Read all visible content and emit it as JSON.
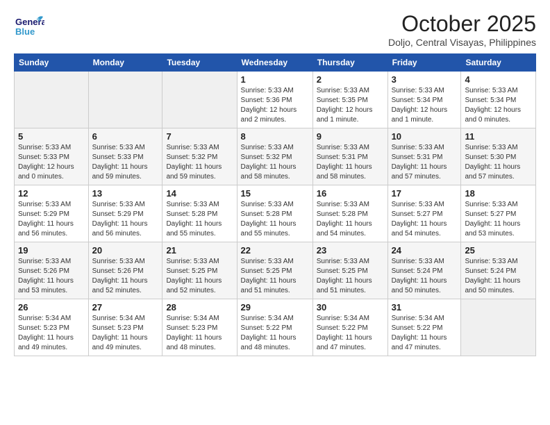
{
  "header": {
    "logo_line1": "General",
    "logo_line2": "Blue",
    "month_title": "October 2025",
    "location": "Doljo, Central Visayas, Philippines"
  },
  "weekdays": [
    "Sunday",
    "Monday",
    "Tuesday",
    "Wednesday",
    "Thursday",
    "Friday",
    "Saturday"
  ],
  "weeks": [
    [
      {
        "day": "",
        "info": ""
      },
      {
        "day": "",
        "info": ""
      },
      {
        "day": "",
        "info": ""
      },
      {
        "day": "1",
        "info": "Sunrise: 5:33 AM\nSunset: 5:36 PM\nDaylight: 12 hours\nand 2 minutes."
      },
      {
        "day": "2",
        "info": "Sunrise: 5:33 AM\nSunset: 5:35 PM\nDaylight: 12 hours\nand 1 minute."
      },
      {
        "day": "3",
        "info": "Sunrise: 5:33 AM\nSunset: 5:34 PM\nDaylight: 12 hours\nand 1 minute."
      },
      {
        "day": "4",
        "info": "Sunrise: 5:33 AM\nSunset: 5:34 PM\nDaylight: 12 hours\nand 0 minutes."
      }
    ],
    [
      {
        "day": "5",
        "info": "Sunrise: 5:33 AM\nSunset: 5:33 PM\nDaylight: 12 hours\nand 0 minutes."
      },
      {
        "day": "6",
        "info": "Sunrise: 5:33 AM\nSunset: 5:33 PM\nDaylight: 11 hours\nand 59 minutes."
      },
      {
        "day": "7",
        "info": "Sunrise: 5:33 AM\nSunset: 5:32 PM\nDaylight: 11 hours\nand 59 minutes."
      },
      {
        "day": "8",
        "info": "Sunrise: 5:33 AM\nSunset: 5:32 PM\nDaylight: 11 hours\nand 58 minutes."
      },
      {
        "day": "9",
        "info": "Sunrise: 5:33 AM\nSunset: 5:31 PM\nDaylight: 11 hours\nand 58 minutes."
      },
      {
        "day": "10",
        "info": "Sunrise: 5:33 AM\nSunset: 5:31 PM\nDaylight: 11 hours\nand 57 minutes."
      },
      {
        "day": "11",
        "info": "Sunrise: 5:33 AM\nSunset: 5:30 PM\nDaylight: 11 hours\nand 57 minutes."
      }
    ],
    [
      {
        "day": "12",
        "info": "Sunrise: 5:33 AM\nSunset: 5:29 PM\nDaylight: 11 hours\nand 56 minutes."
      },
      {
        "day": "13",
        "info": "Sunrise: 5:33 AM\nSunset: 5:29 PM\nDaylight: 11 hours\nand 56 minutes."
      },
      {
        "day": "14",
        "info": "Sunrise: 5:33 AM\nSunset: 5:28 PM\nDaylight: 11 hours\nand 55 minutes."
      },
      {
        "day": "15",
        "info": "Sunrise: 5:33 AM\nSunset: 5:28 PM\nDaylight: 11 hours\nand 55 minutes."
      },
      {
        "day": "16",
        "info": "Sunrise: 5:33 AM\nSunset: 5:28 PM\nDaylight: 11 hours\nand 54 minutes."
      },
      {
        "day": "17",
        "info": "Sunrise: 5:33 AM\nSunset: 5:27 PM\nDaylight: 11 hours\nand 54 minutes."
      },
      {
        "day": "18",
        "info": "Sunrise: 5:33 AM\nSunset: 5:27 PM\nDaylight: 11 hours\nand 53 minutes."
      }
    ],
    [
      {
        "day": "19",
        "info": "Sunrise: 5:33 AM\nSunset: 5:26 PM\nDaylight: 11 hours\nand 53 minutes."
      },
      {
        "day": "20",
        "info": "Sunrise: 5:33 AM\nSunset: 5:26 PM\nDaylight: 11 hours\nand 52 minutes."
      },
      {
        "day": "21",
        "info": "Sunrise: 5:33 AM\nSunset: 5:25 PM\nDaylight: 11 hours\nand 52 minutes."
      },
      {
        "day": "22",
        "info": "Sunrise: 5:33 AM\nSunset: 5:25 PM\nDaylight: 11 hours\nand 51 minutes."
      },
      {
        "day": "23",
        "info": "Sunrise: 5:33 AM\nSunset: 5:25 PM\nDaylight: 11 hours\nand 51 minutes."
      },
      {
        "day": "24",
        "info": "Sunrise: 5:33 AM\nSunset: 5:24 PM\nDaylight: 11 hours\nand 50 minutes."
      },
      {
        "day": "25",
        "info": "Sunrise: 5:33 AM\nSunset: 5:24 PM\nDaylight: 11 hours\nand 50 minutes."
      }
    ],
    [
      {
        "day": "26",
        "info": "Sunrise: 5:34 AM\nSunset: 5:23 PM\nDaylight: 11 hours\nand 49 minutes."
      },
      {
        "day": "27",
        "info": "Sunrise: 5:34 AM\nSunset: 5:23 PM\nDaylight: 11 hours\nand 49 minutes."
      },
      {
        "day": "28",
        "info": "Sunrise: 5:34 AM\nSunset: 5:23 PM\nDaylight: 11 hours\nand 48 minutes."
      },
      {
        "day": "29",
        "info": "Sunrise: 5:34 AM\nSunset: 5:22 PM\nDaylight: 11 hours\nand 48 minutes."
      },
      {
        "day": "30",
        "info": "Sunrise: 5:34 AM\nSunset: 5:22 PM\nDaylight: 11 hours\nand 47 minutes."
      },
      {
        "day": "31",
        "info": "Sunrise: 5:34 AM\nSunset: 5:22 PM\nDaylight: 11 hours\nand 47 minutes."
      },
      {
        "day": "",
        "info": ""
      }
    ]
  ]
}
